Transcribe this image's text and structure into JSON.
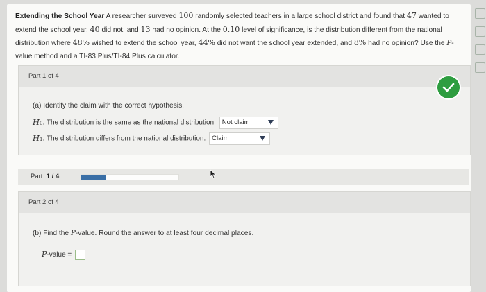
{
  "problem": {
    "title": "Extending the School Year",
    "p1": " A researcher surveyed ",
    "n_surveyed": "100",
    "p2": " randomly selected teachers in a large school district and found that ",
    "n_extend": "47",
    "p3": " wanted to extend the school year, ",
    "n_not": "40",
    "p4": " did not, and ",
    "n_noop": "13",
    "p5": " had no opinion. At the ",
    "alpha": "0.10",
    "p6": " level of significance, is the distribution different from the national distribution where ",
    "pct1": "48%",
    "p7": " wished to extend the school year, ",
    "pct2": "44%",
    "p8": " did not want the school year extended, and ",
    "pct3": "8%",
    "p9": " had no opinion? Use the ",
    "pvar": "P",
    "p10": "-value method and a TI-83 Plus/TI-84 Plus calculator."
  },
  "part1": {
    "header": "Part 1 of 4",
    "question": "(a) Identify the claim with the correct hypothesis.",
    "h0_symbol": "H",
    "h0_sub": "0",
    "h0_text": ": The distribution is the same as the national distribution.",
    "h0_select": "Not claim",
    "h1_symbol": "H",
    "h1_sub": "1",
    "h1_text": ": The distribution differs from the national distribution.",
    "h1_select": "Claim",
    "status": "correct"
  },
  "progress": {
    "label": "Part:",
    "value": "1 / 4",
    "fraction": 0.25,
    "fill_color": "#3a6fa6"
  },
  "part2": {
    "header": "Part 2 of 4",
    "question_a": "(b) Find the ",
    "question_var": "P",
    "question_b": "-value. Round the answer to at least four decimal places.",
    "pvalue_var": "P",
    "pvalue_label": "-value =",
    "pvalue_input": ""
  },
  "colors": {
    "check_green": "#2e9d40",
    "caret": "#2f3d56"
  },
  "icons": [
    "check-icon",
    "caret-down-icon",
    "cursor-icon"
  ]
}
